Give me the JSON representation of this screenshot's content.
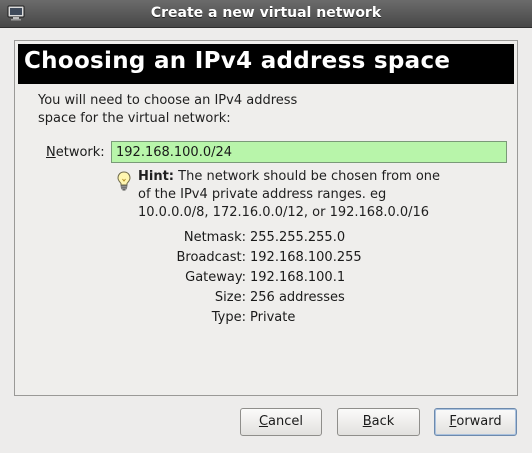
{
  "window": {
    "title": "Create a new virtual network"
  },
  "banner": {
    "title": "Choosing an IPv4 address space"
  },
  "intro": {
    "line1": "You will need to choose an IPv4 address",
    "line2": "space for the virtual network:"
  },
  "network": {
    "label_mnemonic": "N",
    "label_rest": "etwork:",
    "value": "192.168.100.0/24"
  },
  "hint": {
    "bold": "Hint:",
    "line1": " The network should be chosen from one",
    "line2": "of the IPv4 private address ranges. eg",
    "line3": "10.0.0.0/8,  172.16.0.0/12, or 192.168.0.0/16"
  },
  "details": [
    {
      "label": "Netmask:",
      "value": "255.255.255.0"
    },
    {
      "label": "Broadcast:",
      "value": "192.168.100.255"
    },
    {
      "label": "Gateway:",
      "value": "192.168.100.1"
    },
    {
      "label": "Size:",
      "value": "256 addresses"
    },
    {
      "label": "Type:",
      "value": "Private"
    }
  ],
  "buttons": {
    "cancel": {
      "mnemonic": "C",
      "rest": "ancel"
    },
    "back": {
      "mnemonic": "B",
      "rest": "ack"
    },
    "forward": {
      "mnemonic": "F",
      "rest": "orward"
    }
  },
  "colors": {
    "input_valid_bg": "#b8f5aa",
    "banner_bg": "#000000",
    "titlebar_bg": "#5a5a5a"
  },
  "icons": {
    "app": "monitor-icon",
    "hint": "lightbulb-icon"
  }
}
